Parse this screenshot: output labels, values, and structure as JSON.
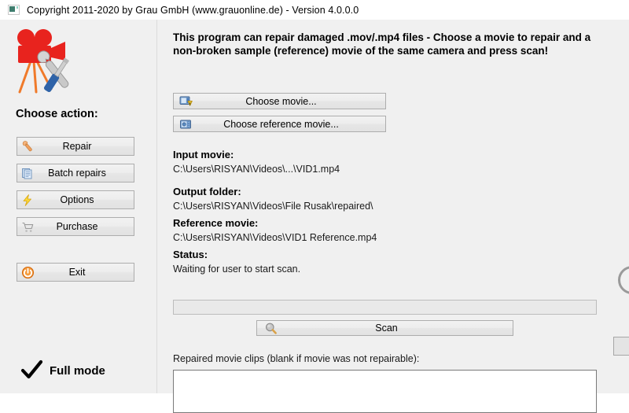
{
  "window": {
    "title": "Copyright 2011-2020 by Grau GmbH (www.grauonline.de) - Version 4.0.0.0",
    "icon": "app-window-icon"
  },
  "sidebar": {
    "logo_icon": "movie-camera-repair-logo",
    "section_label": "Choose action:",
    "actions": [
      {
        "id": "repair",
        "label": "Repair",
        "icon": "wrench-icon"
      },
      {
        "id": "batch",
        "label": "Batch repairs",
        "icon": "stacked-documents-icon"
      },
      {
        "id": "options",
        "label": "Options",
        "icon": "lightning-bolt-icon"
      },
      {
        "id": "purchase",
        "label": "Purchase",
        "icon": "shopping-cart-icon"
      }
    ],
    "exit": {
      "label": "Exit",
      "icon": "power-icon"
    },
    "mode": {
      "label": "Full mode",
      "icon": "checkmark-icon",
      "checked": true
    }
  },
  "main": {
    "heading": "This program can repair damaged .mov/.mp4 files - Choose a movie to repair and a non-broken sample (reference) movie of the same camera and press scan!",
    "choose_movie": {
      "label": "Choose movie...",
      "icon": "movie-warning-icon"
    },
    "choose_reference": {
      "label": "Choose reference movie...",
      "icon": "movie-camera-icon"
    },
    "fields": [
      {
        "id": "input-movie",
        "label": "Input movie:",
        "value": "C:\\Users\\RISYAN\\Videos\\...\\VID1.mp4"
      },
      {
        "id": "output-folder",
        "label": "Output folder:",
        "value": "C:\\Users\\RISYAN\\Videos\\File Rusak\\repaired\\"
      },
      {
        "id": "reference-movie",
        "label": "Reference movie:",
        "value": "C:\\Users\\RISYAN\\Videos\\VID1 Reference.mp4"
      },
      {
        "id": "status",
        "label": "Status:",
        "value": "Waiting for user to start scan."
      }
    ],
    "progress": {
      "percent": 0
    },
    "scan": {
      "label": "Scan",
      "icon": "magnifier-icon"
    },
    "clips": {
      "label": "Repaired movie clips (blank if movie was not repairable):",
      "value": ""
    }
  },
  "colors": {
    "window_background": "#f0f0f0",
    "titlebar_background": "#ffffff",
    "button_face": "#ededed",
    "button_border": "#adadad",
    "accent_red": "#e8231e",
    "accent_orange": "#e87d1e",
    "accent_yellow": "#f5c518",
    "accent_blue": "#3b82c4",
    "text": "#000000"
  }
}
